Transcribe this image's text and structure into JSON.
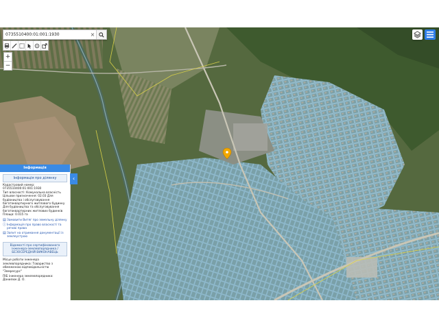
{
  "search": {
    "value": "0735510400:01:001:1930",
    "clear_icon": "×",
    "search_icon": "magnifier-icon"
  },
  "toolbar": {
    "tools": [
      "printer-icon",
      "ruler-icon",
      "measure-icon",
      "cursor-icon",
      "identify-icon",
      "share-icon"
    ]
  },
  "zoom": {
    "in_label": "+",
    "out_label": "−"
  },
  "colors": {
    "accent": "#3a8ae4",
    "marker": "#f3a800",
    "parcel": "#89c2e6"
  },
  "panel": {
    "header": "Інформація",
    "section_title": "Інформація про ділянку",
    "cadastral_label": "Кадастровий номер:",
    "cadastral_value": "0735510400:01:001:1930",
    "ownership": "Тип власності: Комунальна власність",
    "purpose": "Цільове призначення: 02.03 Для будівництва і обслуговування багатоквартирного житлового будинку Для будівництва та обслуговування багатоквартирних житлових будинків",
    "area": "Площа: 0.015 га",
    "link1": "Замовити Витяг про земельну ділянку",
    "link2": "Інформація про право власності та речові права",
    "link3": "Запит на отримання документації із землеустрою",
    "cert_title": "Відомості про сертифікованого інженера-землевпорядника / БЕЗОСЕРЕДНІЙ ВИКОНАВЕЦЬ",
    "cert_label": "БЕЗОСЕРЕДНІЙ ВИКОНАВЕЦЬ",
    "workplace": "Місце роботи інженера землевпорядника: Товариство з обмеженою відповідальністю \"Земресурс\"",
    "engineer": "ПІБ інженера землевпорядника: Данилюк Д. О."
  },
  "footer": {
    "badge": "i"
  }
}
